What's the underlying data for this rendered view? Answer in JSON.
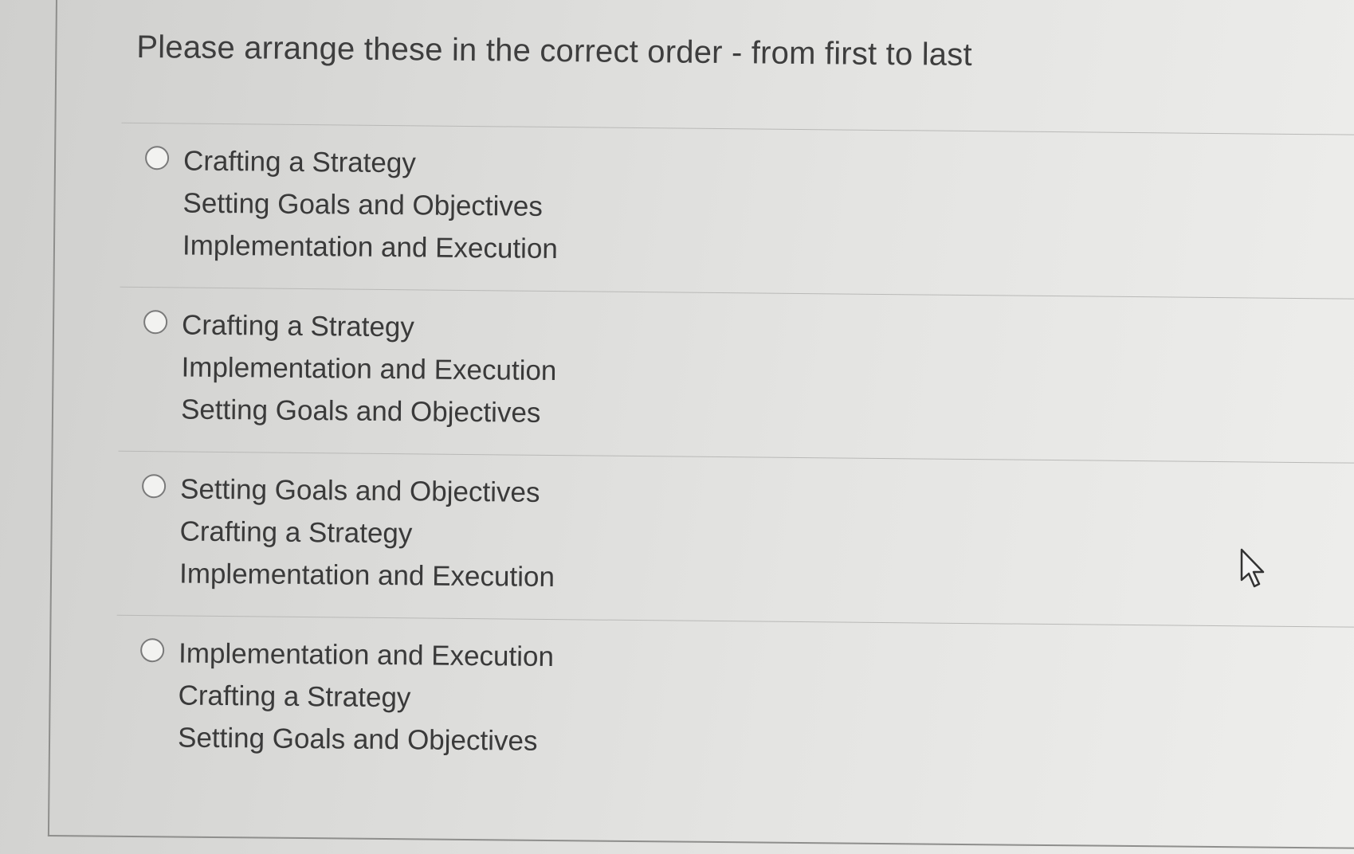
{
  "question": {
    "text": "Please arrange these in the correct order - from first to last"
  },
  "options": [
    {
      "lines": [
        "Crafting a Strategy",
        "Setting Goals and Objectives",
        "Implementation and Execution"
      ]
    },
    {
      "lines": [
        "Crafting a Strategy",
        "Implementation and Execution",
        "Setting Goals and Objectives"
      ]
    },
    {
      "lines": [
        "Setting Goals and Objectives",
        "Crafting a Strategy",
        "Implementation and Execution"
      ]
    },
    {
      "lines": [
        "Implementation and Execution",
        "Crafting a Strategy",
        "Setting Goals and Objectives"
      ]
    }
  ],
  "icons": {
    "radio": "radio-unselected-icon",
    "cursor": "mouse-pointer-icon"
  }
}
